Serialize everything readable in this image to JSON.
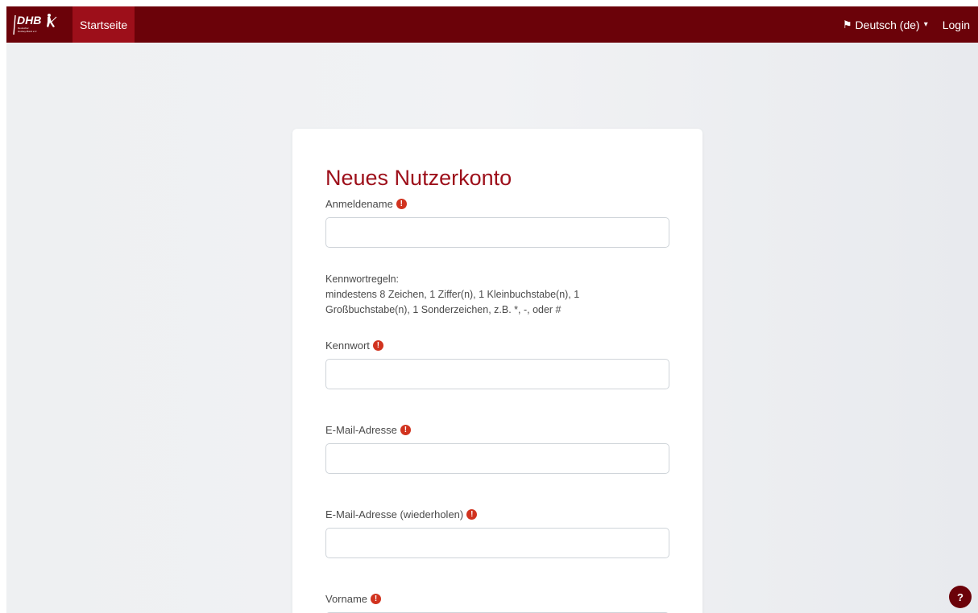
{
  "navbar": {
    "logo_text": "DHB",
    "logo_subtitle": "Deutscher Hockey-Bund e.V.",
    "home_label": "Startseite",
    "language_label": "Deutsch (de)",
    "login_label": "Login"
  },
  "form": {
    "title": "Neues Nutzerkonto",
    "required_icon": "!",
    "fields": [
      {
        "label": "Anmeldename",
        "value": "",
        "placeholder": ""
      },
      {
        "label": "Kennwort",
        "value": "",
        "placeholder": ""
      },
      {
        "label": "E-Mail-Adresse",
        "value": "",
        "placeholder": ""
      },
      {
        "label": "E-Mail-Adresse (wiederholen)",
        "value": "",
        "placeholder": ""
      },
      {
        "label": "Vorname",
        "value": "",
        "placeholder": ""
      }
    ],
    "password_rules": {
      "heading": "Kennwortregeln:",
      "line1": "mindestens 8 Zeichen, 1 Ziffer(n), 1 Kleinbuchstabe(n), 1",
      "line2": "Großbuchstabe(n), 1 Sonderzeichen, z.B. *, -, oder #"
    }
  },
  "help_button": {
    "label": "?"
  },
  "colors": {
    "brand_dark": "#6b0209",
    "brand_red": "#9d0f1a",
    "required_red": "#d1331f"
  },
  "icons": {
    "required": "exclamation-circle-icon",
    "language": "flag-icon",
    "chevron": "chevron-down-icon"
  }
}
